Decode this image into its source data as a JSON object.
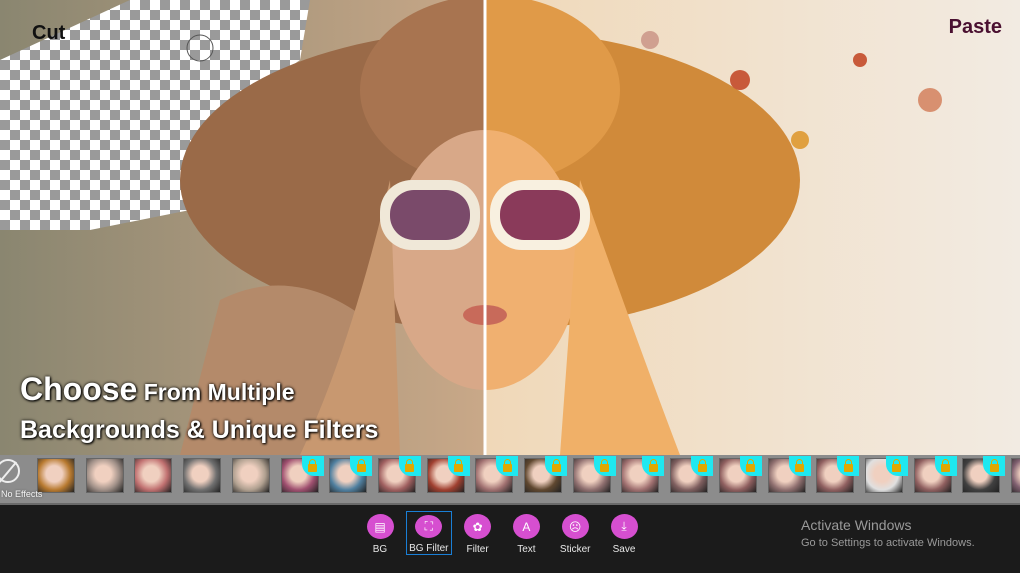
{
  "overlay": {
    "cut_label": "Cut",
    "paste_label": "Paste",
    "headline_big": "Choose",
    "headline_rest": " From Multiple",
    "headline_line2": "Backgrounds & Unique Filters"
  },
  "filters": {
    "no_effects_label": "No Effects",
    "thumb_count": 21,
    "locked_from_index": 5,
    "tints": [
      "#b87a30",
      "#a09088",
      "#c07070",
      "#707070",
      "#b0a090",
      "#a05070",
      "#5080a0",
      "#a06060",
      "#a04030",
      "#a07070",
      "#604830",
      "#907070",
      "#a07070",
      "#806060",
      "#906060",
      "#907070",
      "#906060",
      "#e0e0e0",
      "#906060",
      "#404040",
      "#806070"
    ]
  },
  "toolbar": {
    "items": [
      {
        "label": "BG",
        "icon": "layers-icon",
        "selected": false
      },
      {
        "label": "BG Filter",
        "icon": "bg-filter-icon",
        "selected": true
      },
      {
        "label": "Filter",
        "icon": "filter-icon",
        "selected": false
      },
      {
        "label": "Text",
        "icon": "text-icon",
        "selected": false
      },
      {
        "label": "Sticker",
        "icon": "sticker-icon",
        "selected": false
      },
      {
        "label": "Save",
        "icon": "download-icon",
        "selected": false
      }
    ]
  },
  "watermark": {
    "title": "Activate Windows",
    "subtitle": "Go to Settings to activate Windows."
  },
  "colors": {
    "accent": "#d64fd0",
    "selection": "#1a7fd6",
    "lock_badge": "#1fe8f0"
  }
}
